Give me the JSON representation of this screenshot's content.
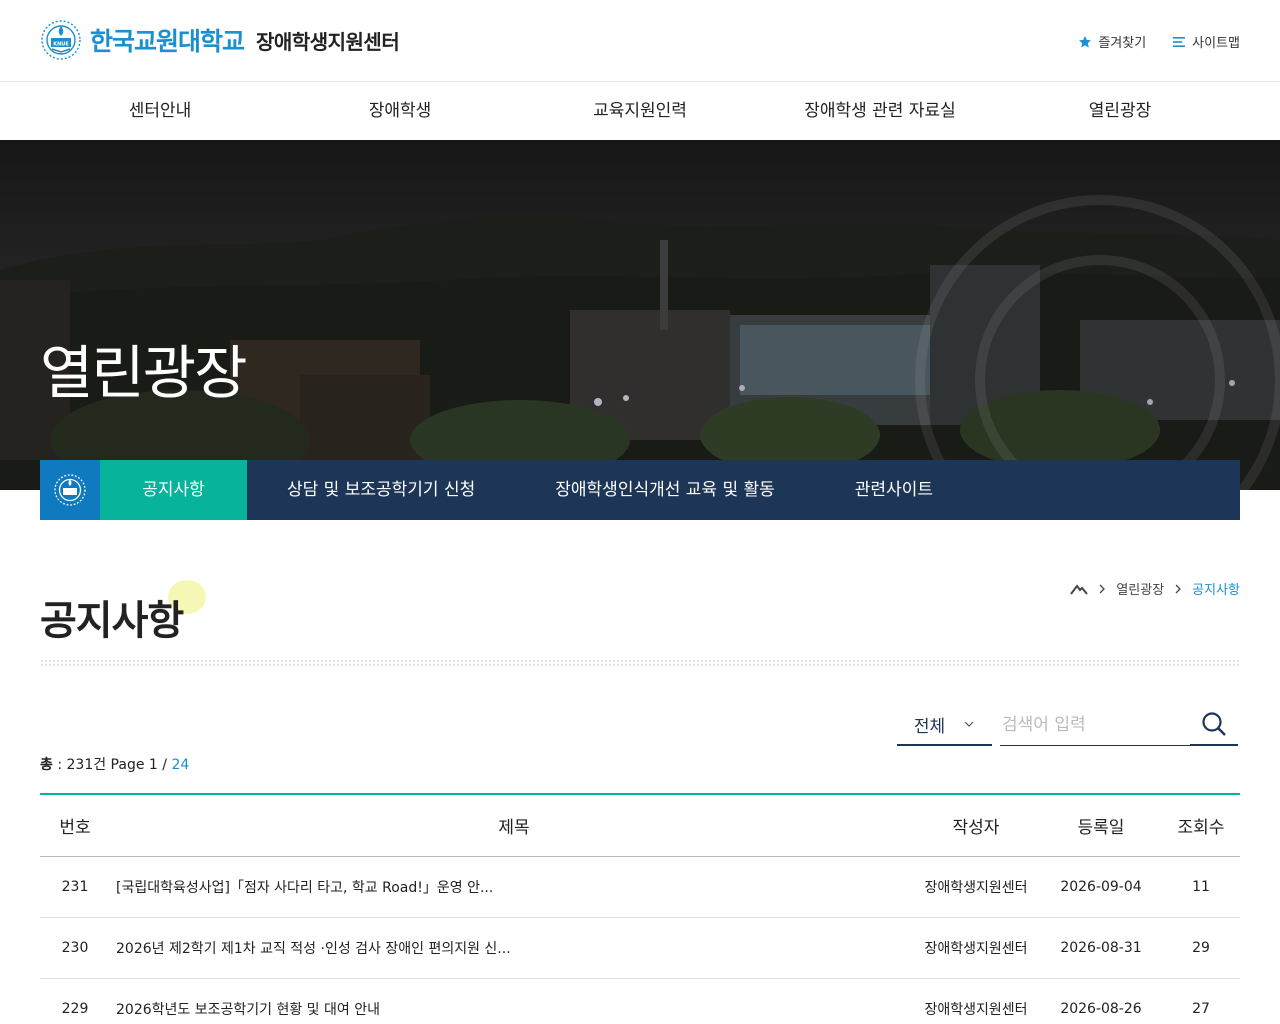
{
  "header": {
    "university_name": "한국교원대학교",
    "center_name": "장애학생지원센터",
    "emblem_text": "KNUE",
    "utility": [
      {
        "label": "즐겨찾기",
        "icon": "star-icon"
      },
      {
        "label": "사이트맵",
        "icon": "menu-icon"
      }
    ]
  },
  "gnb": [
    "센터안내",
    "장애학생",
    "교육지원인력",
    "장애학생 관련 자료실",
    "열린광장"
  ],
  "hero": {
    "title": "열린광장"
  },
  "subnav": {
    "home_icon": "emblem-icon",
    "items": [
      "공지사항",
      "상담 및 보조공학기기 신청",
      "장애학생인식개선 교육 및 활동",
      "관련사이트"
    ],
    "active_index": 0
  },
  "page": {
    "title": "공지사항",
    "breadcrumb": [
      "열린광장",
      "공지사항"
    ]
  },
  "search": {
    "select_value": "전체",
    "placeholder": "검색어 입력"
  },
  "summary": {
    "total_label": "총",
    "total_value": " : 231건 Page 1 / ",
    "total_pages": "24"
  },
  "table": {
    "headers": [
      "번호",
      "제목",
      "작성자",
      "등록일",
      "조회수"
    ],
    "rows": [
      {
        "no": "231",
        "title": "[국립대학육성사업]「점자 사다리 타고, 학교 Road!」운영 안...",
        "writer": "장애학생지원센터",
        "date": "2026-09-04",
        "views": "11"
      },
      {
        "no": "230",
        "title": "2026년 제2학기 제1차 교직 적성 ·인성 검사 장애인 편의지원 신...",
        "writer": "장애학생지원센터",
        "date": "2026-08-31",
        "views": "29"
      },
      {
        "no": "229",
        "title": "2026학년도 보조공학기기 현황 및 대여 안내",
        "writer": "장애학생지원센터",
        "date": "2026-08-26",
        "views": "27"
      }
    ]
  },
  "colors": {
    "brand_blue": "#1b8fcf",
    "navy": "#1d3557",
    "teal": "#08b39c"
  }
}
